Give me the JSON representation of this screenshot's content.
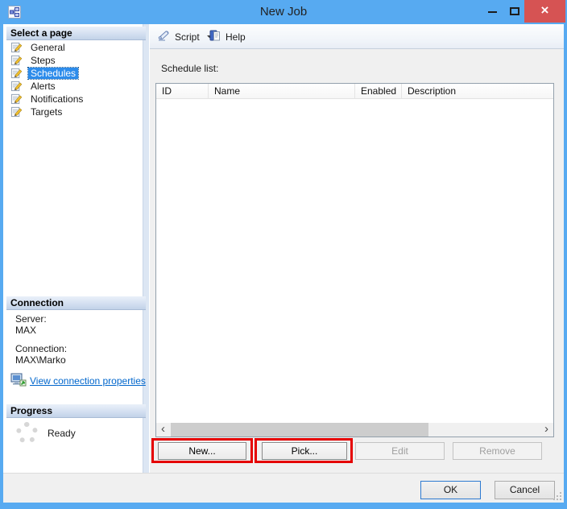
{
  "window": {
    "title": "New Job",
    "close_glyph": "×"
  },
  "sidebar": {
    "select_page": {
      "header": "Select a page",
      "items": [
        {
          "label": "General",
          "selected": false
        },
        {
          "label": "Steps",
          "selected": false
        },
        {
          "label": "Schedules",
          "selected": true
        },
        {
          "label": "Alerts",
          "selected": false
        },
        {
          "label": "Notifications",
          "selected": false
        },
        {
          "label": "Targets",
          "selected": false
        }
      ]
    },
    "connection": {
      "header": "Connection",
      "server_label": "Server:",
      "server_value": "MAX",
      "connection_label": "Connection:",
      "connection_value": "MAX\\Marko",
      "link_label": "View connection properties"
    },
    "progress": {
      "header": "Progress",
      "status": "Ready"
    }
  },
  "toolbar": {
    "script_label": "Script",
    "help_label": "Help"
  },
  "main": {
    "schedule_list_label": "Schedule list:",
    "table": {
      "columns": [
        "ID",
        "Name",
        "Enabled",
        "Description"
      ],
      "rows": []
    },
    "scrollbar": {
      "left_glyph": "‹",
      "right_glyph": "›"
    },
    "action_buttons": [
      {
        "label": "New...",
        "enabled": true,
        "annotated": true
      },
      {
        "label": "Pick...",
        "enabled": true,
        "annotated": true
      },
      {
        "label": "Edit",
        "enabled": false,
        "annotated": false
      },
      {
        "label": "Remove",
        "enabled": false,
        "annotated": false
      }
    ]
  },
  "footer": {
    "ok_label": "OK",
    "cancel_label": "Cancel"
  },
  "colors": {
    "titlebar_blue": "#57aaf1",
    "close_red": "#d65353",
    "selection_blue": "#2d8ceb",
    "annotation_red": "#e50000",
    "link_blue": "#0066cc",
    "panel_gray": "#f0f0f0"
  }
}
